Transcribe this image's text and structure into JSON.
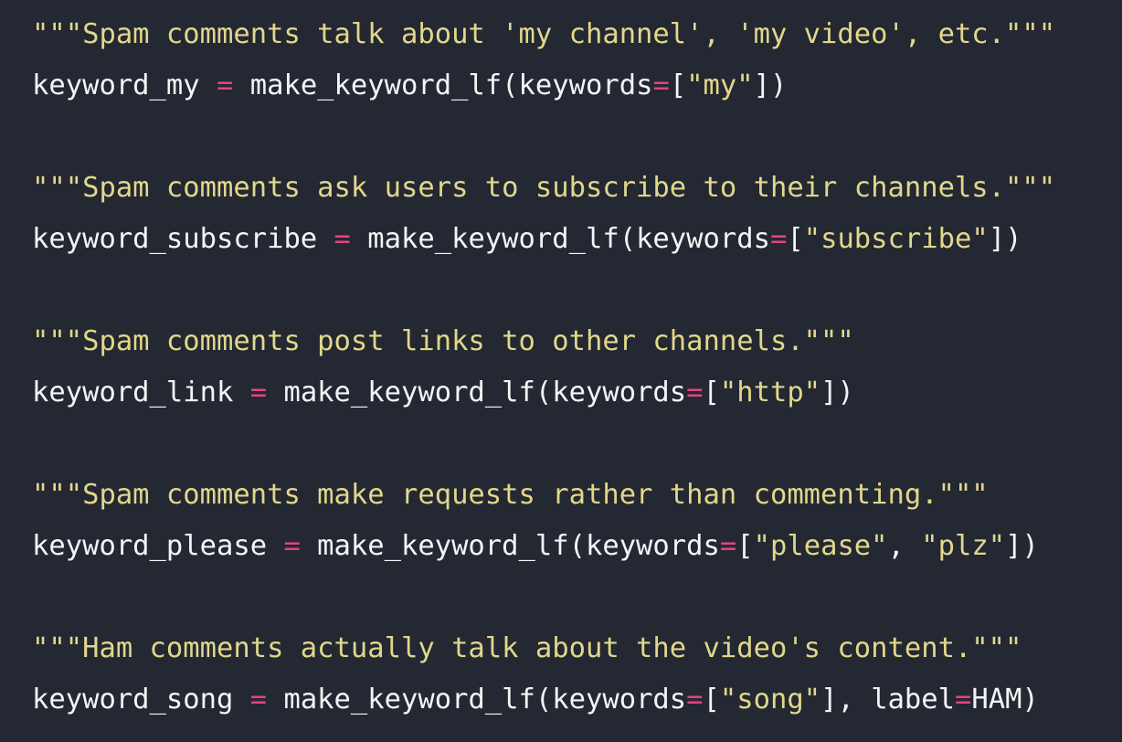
{
  "code": {
    "blocks": [
      {
        "docstring": "\"\"\"Spam comments talk about 'my channel', 'my video', etc.\"\"\"",
        "var": "keyword_my",
        "eq": " = ",
        "call_open": "make_keyword_lf(keywords",
        "kw_eq": "=",
        "list_open": "[",
        "args": [
          {
            "text": "\"my\"",
            "sep": ""
          }
        ],
        "list_close": "]",
        "tail_sep": "",
        "label_kw": "",
        "label_eq": "",
        "label_val": "",
        "call_close": ")"
      },
      {
        "docstring": "\"\"\"Spam comments ask users to subscribe to their channels.\"\"\"",
        "var": "keyword_subscribe",
        "eq": " = ",
        "call_open": "make_keyword_lf(keywords",
        "kw_eq": "=",
        "list_open": "[",
        "args": [
          {
            "text": "\"subscribe\"",
            "sep": ""
          }
        ],
        "list_close": "]",
        "tail_sep": "",
        "label_kw": "",
        "label_eq": "",
        "label_val": "",
        "call_close": ")"
      },
      {
        "docstring": "\"\"\"Spam comments post links to other channels.\"\"\"",
        "var": "keyword_link",
        "eq": " = ",
        "call_open": "make_keyword_lf(keywords",
        "kw_eq": "=",
        "list_open": "[",
        "args": [
          {
            "text": "\"http\"",
            "sep": ""
          }
        ],
        "list_close": "]",
        "tail_sep": "",
        "label_kw": "",
        "label_eq": "",
        "label_val": "",
        "call_close": ")"
      },
      {
        "docstring": "\"\"\"Spam comments make requests rather than commenting.\"\"\"",
        "var": "keyword_please",
        "eq": " = ",
        "call_open": "make_keyword_lf(keywords",
        "kw_eq": "=",
        "list_open": "[",
        "args": [
          {
            "text": "\"please\"",
            "sep": ", "
          },
          {
            "text": "\"plz\"",
            "sep": ""
          }
        ],
        "list_close": "]",
        "tail_sep": "",
        "label_kw": "",
        "label_eq": "",
        "label_val": "",
        "call_close": ")"
      },
      {
        "docstring": "\"\"\"Ham comments actually talk about the video's content.\"\"\"",
        "var": "keyword_song",
        "eq": " = ",
        "call_open": "make_keyword_lf(keywords",
        "kw_eq": "=",
        "list_open": "[",
        "args": [
          {
            "text": "\"song\"",
            "sep": ""
          }
        ],
        "list_close": "]",
        "tail_sep": ", ",
        "label_kw": "label",
        "label_eq": "=",
        "label_val": "HAM",
        "call_close": ")"
      }
    ]
  },
  "colors": {
    "background": "#232833",
    "default_text": "#f4f4f4",
    "string": "#e2d78a",
    "operator": "#e6437b"
  }
}
